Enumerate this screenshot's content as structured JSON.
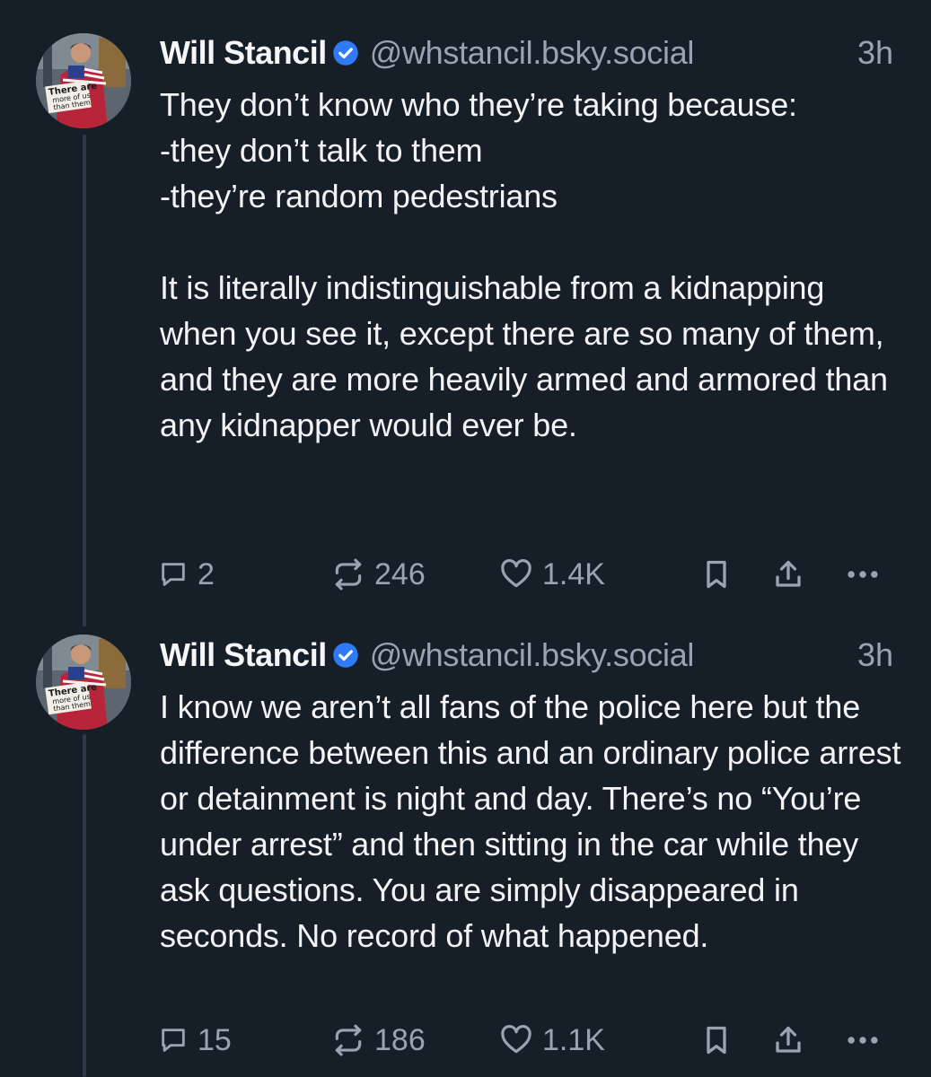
{
  "colors": {
    "background": "#161e27",
    "text": "#f1f3f5",
    "muted": "#98a4b3",
    "verified": "#2f7af6",
    "thread_line": "#2e3a48"
  },
  "posts": [
    {
      "author": {
        "display_name": "Will Stancil",
        "handle": "@whstancil.bsky.social",
        "avatar_sign": "There are more of us than them",
        "verified_icon": "verified-badge-icon"
      },
      "timestamp": "3h",
      "text": "They don’t know who they’re taking because:\n-they don’t talk to them\n-they’re random pedestrians\n\nIt is literally indistinguishable from a kidnapping when you see it, except there are so many of them, and they are more heavily armed and armored than any kidnapper would ever be.",
      "actions": {
        "replies": "2",
        "reposts": "246",
        "likes": "1.4K",
        "icons": [
          "reply-icon",
          "repost-icon",
          "like-icon",
          "bookmark-icon",
          "share-icon",
          "more-icon"
        ]
      }
    },
    {
      "author": {
        "display_name": "Will Stancil",
        "handle": "@whstancil.bsky.social",
        "avatar_sign": "There are more of us than them",
        "verified_icon": "verified-badge-icon"
      },
      "timestamp": "3h",
      "text": "I know we aren’t all fans of the police here but the difference between this and an ordinary police arrest or detainment is night and day. There’s no “You’re under arrest” and then sitting in the car while they ask questions. You are simply disappeared in seconds. No record of what happened.",
      "actions": {
        "replies": "15",
        "reposts": "186",
        "likes": "1.1K",
        "icons": [
          "reply-icon",
          "repost-icon",
          "like-icon",
          "bookmark-icon",
          "share-icon",
          "more-icon"
        ]
      }
    }
  ]
}
